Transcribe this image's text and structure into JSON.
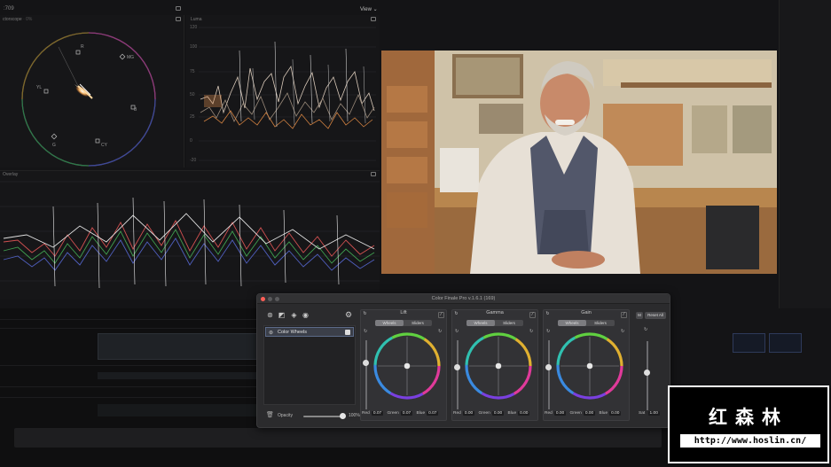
{
  "scopes": {
    "frame_label": ":709",
    "view_label": "View ⌄",
    "vectorscope_title": "ctorscope",
    "vectorscope_sub": "· 0%",
    "vectorscope_targets": [
      "R",
      "MG",
      "B",
      "CY",
      "G",
      "YL"
    ],
    "luma_title": "Luma",
    "luma_axis": [
      "120",
      "100",
      "75",
      "50",
      "25",
      "0",
      "-20"
    ],
    "overlay_title": "Overlay"
  },
  "plugin": {
    "title": "Color Finale Pro v.1.6.1 (169)",
    "list_item": "Color Wheels",
    "opacity_label": "Opacity",
    "opacity_value": "100%",
    "opacity_fraction": 1.0,
    "wheels_label": "Wheels",
    "sliders_label": "Sliders",
    "reset_all": "Reset All",
    "m_label": "M",
    "panels": [
      {
        "title": "Lift",
        "red": "0.07",
        "green": "0.07",
        "blue": "0.07"
      },
      {
        "title": "Gamma",
        "red": "0.00",
        "green": "0.00",
        "blue": "0.00"
      },
      {
        "title": "Gain",
        "red": "0.00",
        "green": "0.00",
        "blue": "0.00"
      }
    ],
    "red_label": "Red",
    "green_label": "Green",
    "blue_label": "Blue",
    "sat_label": "Sat",
    "sat_value": "1.00"
  },
  "watermark": {
    "chinese": "红森林",
    "url": "http://www.hoslin.cn/"
  },
  "colors": {
    "accent": "#5b6a88",
    "close": "#ff5f57"
  }
}
